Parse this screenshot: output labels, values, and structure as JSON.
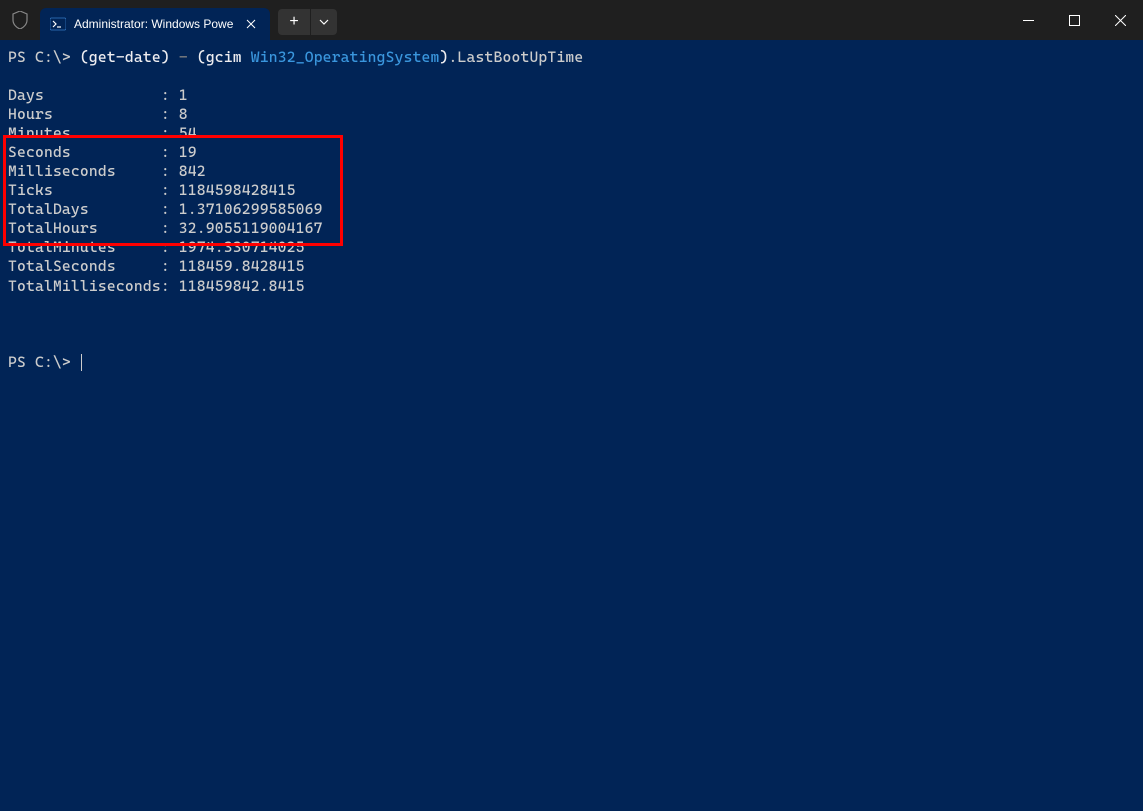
{
  "titlebar": {
    "tab_title": "Administrator: Windows Powe",
    "new_tab_label": "+",
    "dropdown_label": "⌄"
  },
  "command": {
    "prompt": "PS C:\\> ",
    "part1": "(",
    "part2": "get-date",
    "part3": ")",
    "part4": " - ",
    "part5": "(",
    "part6": "gcim",
    "part7": " Win32_OperatingSystem",
    "part8": ")",
    "part9": ".LastBootUpTime"
  },
  "output": [
    {
      "key": "Days",
      "value": "1"
    },
    {
      "key": "Hours",
      "value": "8"
    },
    {
      "key": "Minutes",
      "value": "54"
    },
    {
      "key": "Seconds",
      "value": "19"
    },
    {
      "key": "Milliseconds",
      "value": "842"
    },
    {
      "key": "Ticks",
      "value": "1184598428415"
    },
    {
      "key": "TotalDays",
      "value": "1.37106299585069"
    },
    {
      "key": "TotalHours",
      "value": "32.9055119004167"
    },
    {
      "key": "TotalMinutes",
      "value": "1974.330714025"
    },
    {
      "key": "TotalSeconds",
      "value": "118459.8428415"
    },
    {
      "key": "TotalMilliseconds",
      "value": "118459842.8415"
    }
  ],
  "prompt2": "PS C:\\> "
}
